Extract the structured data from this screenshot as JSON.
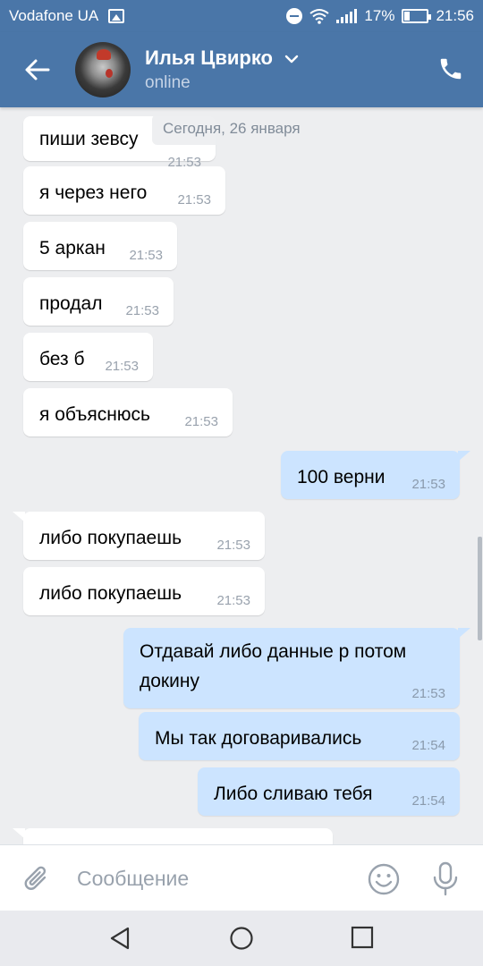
{
  "status_bar": {
    "carrier": "Vodafone UA",
    "battery": "17%",
    "time": "21:56"
  },
  "header": {
    "name": "Илья Цвирко",
    "status": "online"
  },
  "date_chip": "Сегодня, 26 января",
  "messages": [
    {
      "dir": "in",
      "text": "пиши зевсу",
      "time": "21:53"
    },
    {
      "dir": "in",
      "text": "я через него",
      "time": "21:53"
    },
    {
      "dir": "in",
      "text": "5 аркан",
      "time": "21:53"
    },
    {
      "dir": "in",
      "text": "продал",
      "time": "21:53"
    },
    {
      "dir": "in",
      "text": "без б",
      "time": "21:53"
    },
    {
      "dir": "in",
      "text": "я объяснюсь",
      "time": "21:53"
    },
    {
      "dir": "out",
      "text": "100 верни",
      "time": "21:53"
    },
    {
      "dir": "in",
      "text": "либо покупаешь",
      "time": "21:53"
    },
    {
      "dir": "in",
      "text": "либо покупаешь",
      "time": "21:53"
    },
    {
      "dir": "out",
      "text": "Отдавай либо данные р потом докину",
      "time": "21:53"
    },
    {
      "dir": "out",
      "text": "Мы так договаривались",
      "time": "21:54"
    },
    {
      "dir": "out",
      "text": "Либо сливаю тебя",
      "time": "21:54"
    }
  ],
  "composer": {
    "placeholder": "Сообщение"
  },
  "colors": {
    "header": "#4a76a8",
    "incoming_bubble": "#ffffff",
    "outgoing_bubble": "#cce4ff",
    "background": "#edeef0"
  },
  "icons": [
    "image-icon",
    "dnd-icon",
    "wifi-icon",
    "signal-icon",
    "battery-icon",
    "back-arrow-icon",
    "chevron-down-icon",
    "phone-icon",
    "paperclip-icon",
    "emoji-icon",
    "microphone-icon",
    "nav-back-icon",
    "nav-home-icon",
    "nav-recent-apps-icon"
  ]
}
